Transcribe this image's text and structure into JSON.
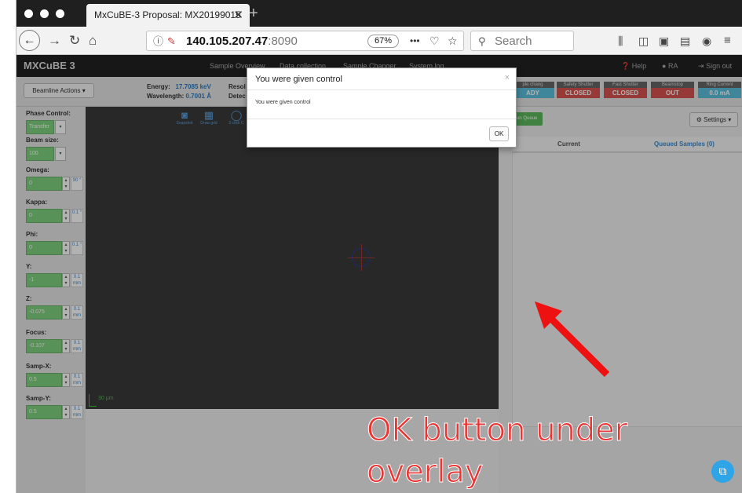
{
  "browser": {
    "tab_title": "MxCuBE-3 Proposal: MX20199015",
    "tab_close": "✕",
    "new_tab": "+",
    "url_host": "140.105.207.47",
    "url_port": ":8090",
    "zoom": "67%",
    "page_actions": "•••",
    "search_placeholder": "Search"
  },
  "app": {
    "brand": "MXCuBE 3",
    "nav": [
      "Sample Overview",
      "Data collection",
      "Sample Changer",
      "System log"
    ],
    "help": "Help",
    "user": "RA",
    "sign_out": "Sign out",
    "beamline_actions": "Beamline Actions ▾",
    "energy_label": "Energy:",
    "energy_value": "17.7085 keV",
    "wavelength_label": "Wavelength:",
    "wavelength_value": "0.7001 Å",
    "resolution_label": "Resol",
    "detector_label": "Detec",
    "statuses": [
      {
        "caption": "ple chang",
        "value": "ADY",
        "color": "#5bc0de"
      },
      {
        "caption": "Safety Shutter",
        "value": "CLOSED",
        "color": "#d9534f"
      },
      {
        "caption": "Fast Shutter",
        "value": "CLOSED",
        "color": "#d9534f"
      },
      {
        "caption": "Beamstop",
        "value": "OUT",
        "color": "#d9534f"
      },
      {
        "caption": "Ring Current",
        "value": "0.0 mA",
        "color": "#5bc0de"
      }
    ]
  },
  "motors": [
    {
      "label": "Phase Control:",
      "value": "Transfer"
    },
    {
      "label": "Beam size:",
      "value": "100"
    },
    {
      "label": "Omega:",
      "value": "0",
      "step": "90 °"
    },
    {
      "label": "Kappa:",
      "value": "0",
      "step": "0.1 °"
    },
    {
      "label": "Phi:",
      "value": "0",
      "step": "0.1 °"
    },
    {
      "label": "Y:",
      "value": "-1",
      "step": "0.1 mm"
    },
    {
      "label": "Z:",
      "value": "-0.075",
      "step": "0.1 mm"
    },
    {
      "label": "Focus:",
      "value": "-0.107",
      "step": "0.1 mm"
    },
    {
      "label": "Samp-X:",
      "value": "0.5",
      "step": "0.1 mm"
    },
    {
      "label": "Samp-Y:",
      "value": "0.5",
      "step": "0.1 mm"
    }
  ],
  "video": {
    "tools": [
      "Snapshot",
      "Draw grid",
      "2-click C"
    ],
    "scale_label": "30 µm"
  },
  "queue": {
    "run_queue": "Run Queue",
    "settings": "⚙ Settings ▾",
    "tab_current": "Current",
    "tab_queued": "Queued Samples (0)"
  },
  "modal": {
    "title": "You were given control",
    "close": "×",
    "body": "You were given control",
    "ok": "OK"
  },
  "annotation": {
    "line1": "OK button under",
    "line2": "overlay",
    "arrow_color": "#ee1111"
  }
}
